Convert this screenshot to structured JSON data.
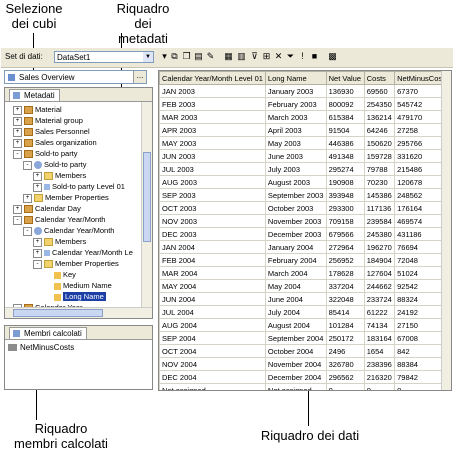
{
  "callouts": {
    "cube_selection": "Selezione\ndei cubi",
    "metadata_pane": "Riquadro dei\nmetadati",
    "calc_members_pane": "Riquadro\nmembri calcolati",
    "data_pane": "Riquadro dei dati"
  },
  "toolbar": {
    "dataset_label": "Set di dati:",
    "dataset_value": "DataSet1"
  },
  "cube": {
    "name": "Sales Overview",
    "more_label": "..."
  },
  "metadata": {
    "tab_label": "Metadati",
    "tree": [
      {
        "label": "Material",
        "icon": "cube-icon",
        "expander": "+"
      },
      {
        "label": "Material group",
        "icon": "cube-icon",
        "expander": "+"
      },
      {
        "label": "Sales Personnel",
        "icon": "cube-icon",
        "expander": "+"
      },
      {
        "label": "Sales organization",
        "icon": "cube-icon",
        "expander": "+"
      },
      {
        "label": "Sold-to party",
        "icon": "cube-icon",
        "expander": "-"
      },
      {
        "label": "Sold-to party",
        "icon": "hierarchy-icon",
        "expander": "-"
      },
      {
        "label": "Members",
        "icon": "folder-icon",
        "expander": "+"
      },
      {
        "label": "Sold-to party Level 01",
        "icon": "level-icon",
        "expander": "+"
      },
      {
        "label": "Member Properties",
        "icon": "folder-icon",
        "expander": "+"
      },
      {
        "label": "Calendar Day",
        "icon": "cube-icon",
        "expander": "+"
      },
      {
        "label": "Calendar Year/Month",
        "icon": "cube-icon",
        "expander": "-"
      },
      {
        "label": "Calendar Year/Month",
        "icon": "hierarchy-icon",
        "expander": "-"
      },
      {
        "label": "Members",
        "icon": "folder-icon",
        "expander": "+"
      },
      {
        "label": "Calendar Year/Month Le",
        "icon": "level-icon",
        "expander": "+"
      },
      {
        "label": "Member Properties",
        "icon": "folder-icon",
        "expander": "-"
      },
      {
        "label": "Key",
        "icon": "attribute-icon",
        "expander": ""
      },
      {
        "label": "Medium Name",
        "icon": "attribute-icon",
        "expander": ""
      },
      {
        "label": "Long Name",
        "icon": "attribute-icon",
        "expander": "",
        "selected": true
      },
      {
        "label": "Calendar Year",
        "icon": "cube-icon",
        "expander": "-"
      },
      {
        "label": "Calendar Year",
        "icon": "hierarchy-icon",
        "expander": "+"
      }
    ]
  },
  "calc_members": {
    "tab_label": "Membri calcolati",
    "items": [
      "NetMinusCosts"
    ]
  },
  "grid": {
    "columns": [
      "Calendar Year/Month Level 01",
      "Long Name",
      "Net Value",
      "Costs",
      "NetMinusCosts"
    ],
    "rows": [
      [
        "JAN 2003",
        "January 2003",
        "136930",
        "69560",
        "67370"
      ],
      [
        "FEB 2003",
        "February 2003",
        "800092",
        "254350",
        "545742"
      ],
      [
        "MAR 2003",
        "March 2003",
        "615384",
        "136214",
        "479170"
      ],
      [
        "APR 2003",
        "April 2003",
        "91504",
        "64246",
        "27258"
      ],
      [
        "MAY 2003",
        "May 2003",
        "446386",
        "150620",
        "295766"
      ],
      [
        "JUN 2003",
        "June 2003",
        "491348",
        "159728",
        "331620"
      ],
      [
        "JUL 2003",
        "July 2003",
        "295274",
        "79788",
        "215486"
      ],
      [
        "AUG 2003",
        "August 2003",
        "190908",
        "70230",
        "120678"
      ],
      [
        "SEP 2003",
        "September 2003",
        "393948",
        "145386",
        "248562"
      ],
      [
        "OCT 2003",
        "October 2003",
        "293300",
        "117136",
        "176164"
      ],
      [
        "NOV 2003",
        "November 2003",
        "709158",
        "239584",
        "469574"
      ],
      [
        "DEC 2003",
        "December 2003",
        "679566",
        "245380",
        "431186"
      ],
      [
        "JAN 2004",
        "January 2004",
        "272964",
        "196270",
        "76694"
      ],
      [
        "FEB 2004",
        "February 2004",
        "256952",
        "184904",
        "72048"
      ],
      [
        "MAR 2004",
        "March 2004",
        "178628",
        "127604",
        "51024"
      ],
      [
        "MAY 2004",
        "May 2004",
        "337204",
        "244662",
        "92542"
      ],
      [
        "JUN 2004",
        "June 2004",
        "322048",
        "233724",
        "88324"
      ],
      [
        "JUL 2004",
        "July 2004",
        "85414",
        "61222",
        "24192"
      ],
      [
        "AUG 2004",
        "August 2004",
        "101284",
        "74134",
        "27150"
      ],
      [
        "SEP 2004",
        "September 2004",
        "250172",
        "183164",
        "67008"
      ],
      [
        "OCT 2004",
        "October 2004",
        "2496",
        "1654",
        "842"
      ],
      [
        "NOV 2004",
        "November 2004",
        "326780",
        "238396",
        "88384"
      ],
      [
        "DEC 2004",
        "December 2004",
        "296562",
        "216320",
        "79842"
      ],
      [
        "Not assigned",
        "Not assigned",
        "0",
        "0",
        "0"
      ]
    ]
  }
}
